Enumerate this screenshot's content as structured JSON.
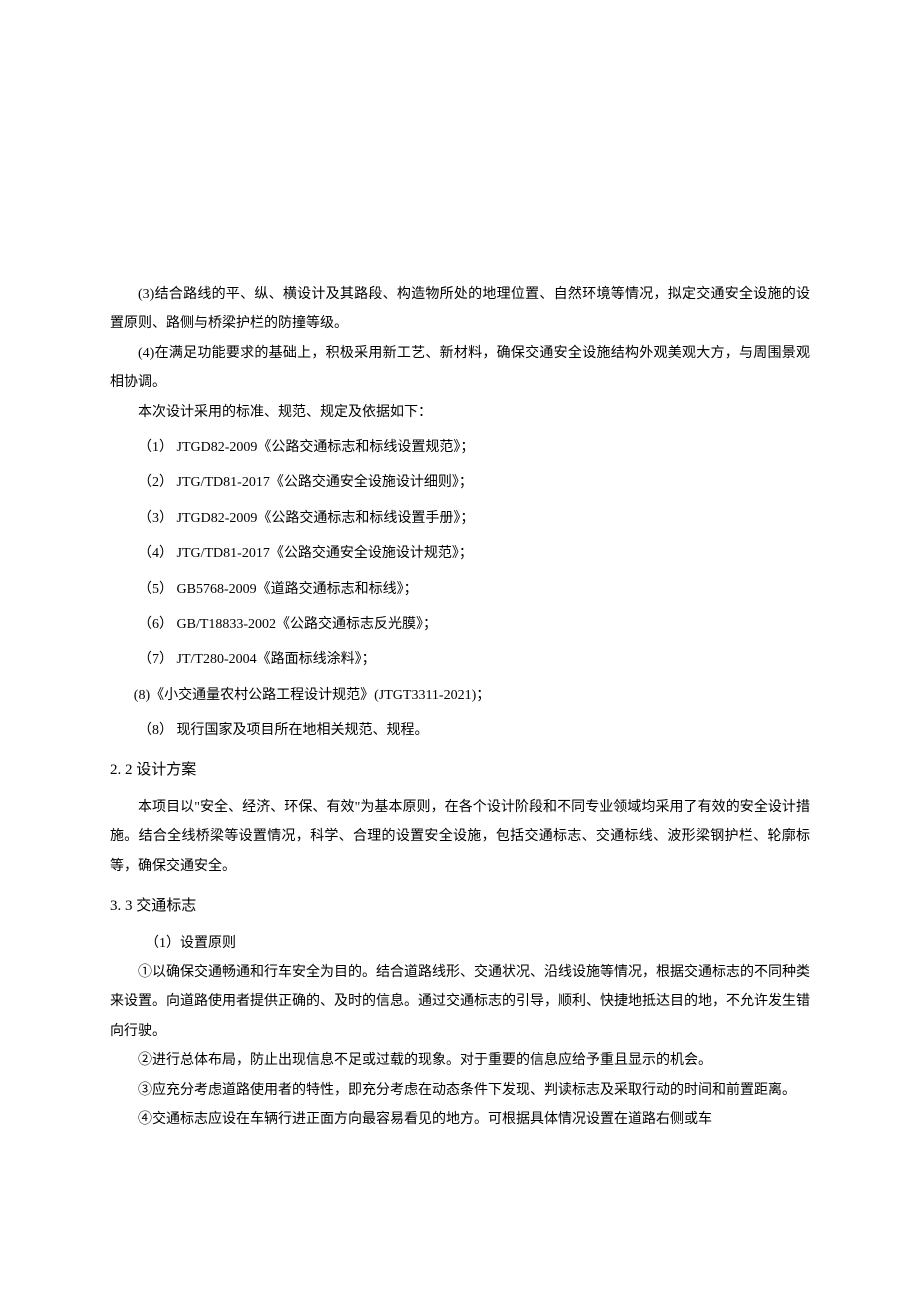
{
  "paragraphs": {
    "p3": "(3)结合路线的平、纵、横设计及其路段、构造物所处的地理位置、自然环境等情况，拟定交通安全设施的设置原则、路侧与桥梁护栏的防撞等级。",
    "p4": "(4)在满足功能要求的基础上，积极采用新工艺、新材料，确保交通安全设施结构外观美观大方，与周围景观相协调。",
    "intro": "本次设计采用的标准、规范、规定及依据如下："
  },
  "standards": [
    "（1）  JTGD82-2009《公路交通标志和标线设置规范》；",
    "（2）  JTG/TD81-2017《公路交通安全设施设计细则》；",
    "（3）  JTGD82-2009《公路交通标志和标线设置手册》；",
    "（4）  JTG/TD81-2017《公路交通安全设施设计规范》；",
    "（5）  GB5768-2009《道路交通标志和标线》；",
    "（6）  GB/T18833-2002《公路交通标志反光膜》；",
    "（7）  JT/T280-2004《路面标线涂料》；",
    "(8)《小交通量农村公路工程设计规范》(JTGT3311-2021)；",
    "（8）  现行国家及项目所在地相关规范、规程。"
  ],
  "section2": {
    "heading": "2.  2 设计方案",
    "body": "本项目以\"安全、经济、环保、有效\"为基本原则，在各个设计阶段和不同专业领域均采用了有效的安全设计措施。结合全线桥梁等设置情况，科学、合理的设置安全设施，包括交通标志、交通标线、波形梁钢护栏、轮廓标等，确保交通安全。"
  },
  "section3": {
    "heading": "3.  3 交通标志",
    "sub1_title": "（1）设置原则",
    "sub1_items": [
      "①以确保交通畅通和行车安全为目的。结合道路线形、交通状况、沿线设施等情况，根据交通标志的不同种类来设置。向道路使用者提供正确的、及时的信息。通过交通标志的引导，顺利、快捷地抵达目的地，不允许发生错向行驶。",
      "②进行总体布局，防止出现信息不足或过载的现象。对于重要的信息应给予重且显示的机会。",
      "③应充分考虑道路使用者的特性，即充分考虑在动态条件下发现、判读标志及采取行动的时间和前置距离。",
      "④交通标志应设在车辆行进正面方向最容易看见的地方。可根据具体情况设置在道路右侧或车"
    ]
  }
}
